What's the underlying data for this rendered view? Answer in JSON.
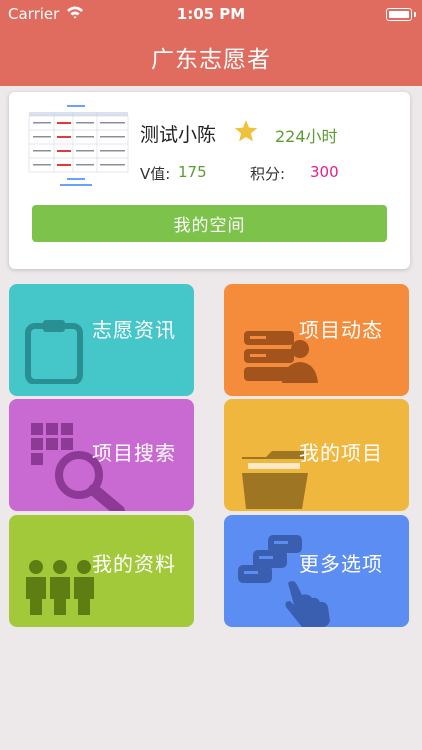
{
  "status_bar": {
    "carrier": "Carrier",
    "time": "1:05 PM"
  },
  "header": {
    "title": "广东志愿者"
  },
  "profile": {
    "name": "测试小陈",
    "hours": "224小时",
    "v_label": "V值:",
    "v_value": "175",
    "points_label": "积分:",
    "points_value": "300",
    "space_button": "我的空间"
  },
  "menu": {
    "news": {
      "label": "志愿资讯",
      "icon": "clipboard-icon",
      "color": "#45c6c8"
    },
    "dynamics": {
      "label": "项目动态",
      "icon": "database-user-icon",
      "color": "#f58c3b"
    },
    "search": {
      "label": "项目搜索",
      "icon": "grid-search-icon",
      "color": "#c86ad1"
    },
    "my_projects": {
      "label": "我的项目",
      "icon": "folder-icon",
      "color": "#f0b73f"
    },
    "my_profile": {
      "label": "我的资料",
      "icon": "people-icon",
      "color": "#a1c93a"
    },
    "more": {
      "label": "更多选项",
      "icon": "cards-tap-icon",
      "color": "#5b8df2"
    }
  }
}
